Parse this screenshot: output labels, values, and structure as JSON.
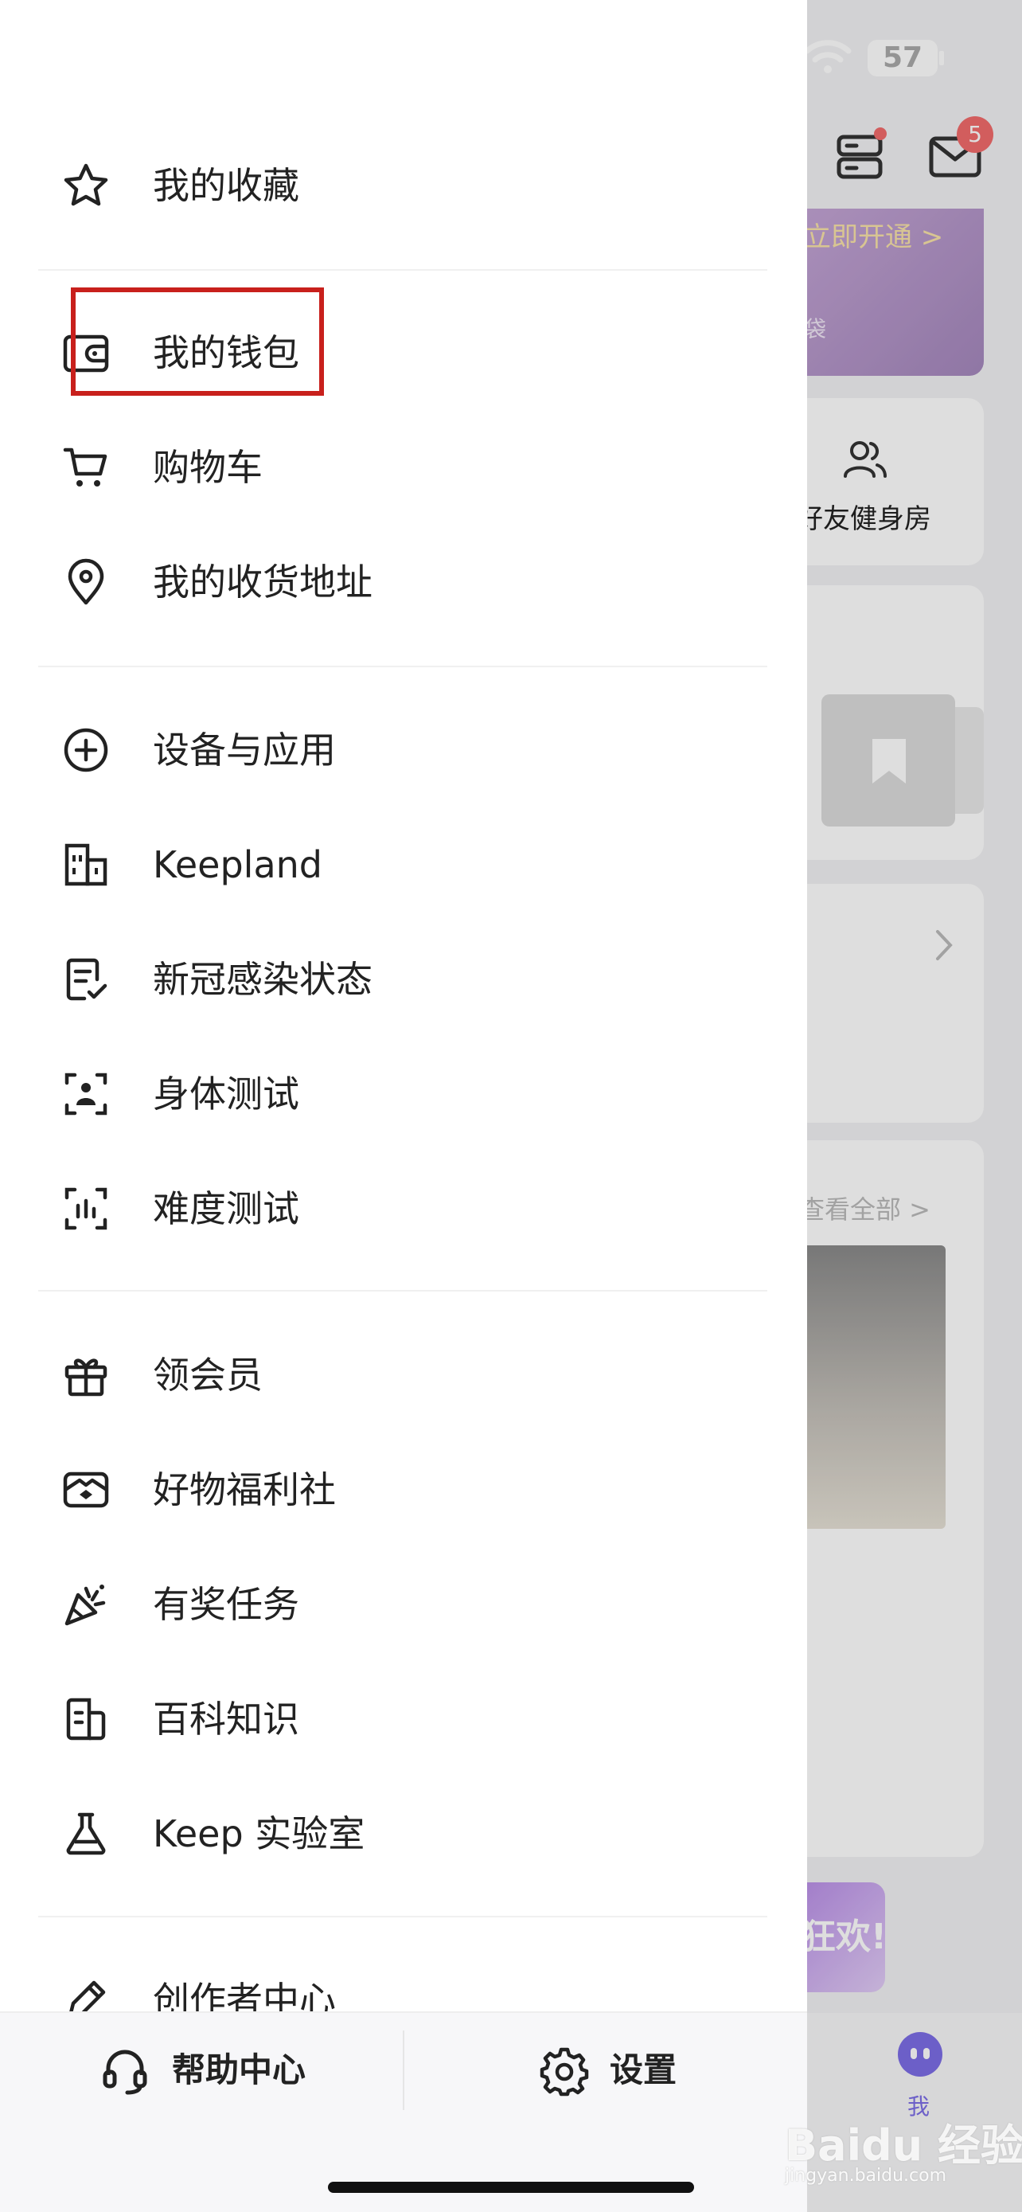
{
  "status_bar": {
    "battery": "57"
  },
  "background": {
    "mail_badge": "5",
    "vip_open": "立即开通 >",
    "vip_sub": "袋",
    "friends_label": "好友健身房",
    "view_all": "查看全部 >",
    "promo_text": "狂欢!",
    "tab_me_label": "我"
  },
  "drawer": {
    "items": [
      {
        "label": "我的收藏",
        "icon": "star-icon"
      },
      {
        "label": "我的钱包",
        "icon": "wallet-icon"
      },
      {
        "label": "购物车",
        "icon": "cart-icon"
      },
      {
        "label": "我的收货地址",
        "icon": "location-pin-icon"
      },
      {
        "label": "设备与应用",
        "icon": "plus-circle-icon"
      },
      {
        "label": "Keepland",
        "icon": "building-icon"
      },
      {
        "label": "新冠感染状态",
        "icon": "checklist-icon"
      },
      {
        "label": "身体测试",
        "icon": "body-scan-icon"
      },
      {
        "label": "难度测试",
        "icon": "difficulty-scan-icon"
      },
      {
        "label": "领会员",
        "icon": "gift-icon"
      },
      {
        "label": "好物福利社",
        "icon": "ticket-icon"
      },
      {
        "label": "有奖任务",
        "icon": "party-popper-icon"
      },
      {
        "label": "百科知识",
        "icon": "encyclopedia-icon"
      },
      {
        "label": "Keep 实验室",
        "icon": "flask-icon"
      },
      {
        "label": "创作者中心",
        "icon": "creator-pen-icon"
      }
    ],
    "footer": {
      "help_label": "帮助中心",
      "settings_label": "设置"
    }
  },
  "watermark": {
    "main": "Baidu 经验",
    "sub": "jingyan.baidu.com"
  }
}
